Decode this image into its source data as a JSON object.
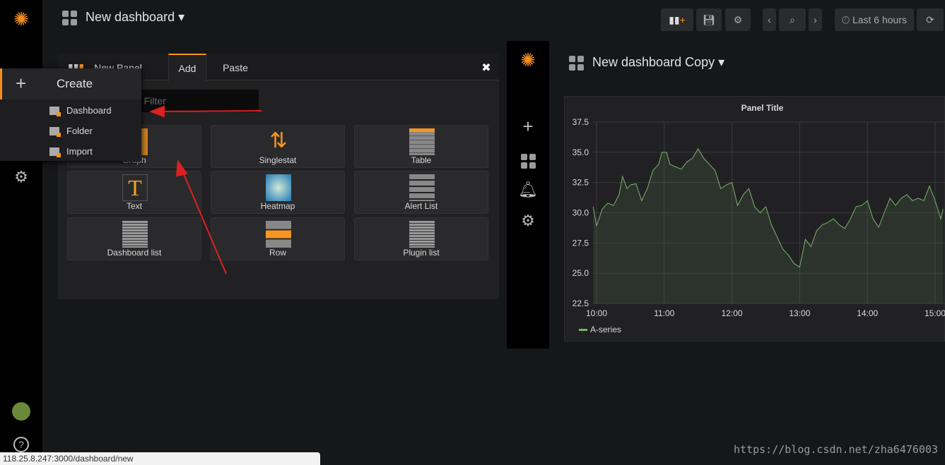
{
  "top": {
    "title": "New dashboard",
    "time_range": "Last 6 hours"
  },
  "editor": {
    "panel_label": "New Panel",
    "tabs": [
      "Add",
      "Paste"
    ],
    "active_tab": "Add",
    "filter_placeholder": "Search Filter",
    "filter_visible": "h Filter",
    "panels": [
      "Graph",
      "Singlestat",
      "Table",
      "Text",
      "Heatmap",
      "Alert List",
      "Dashboard list",
      "Row",
      "Plugin list"
    ]
  },
  "create_menu": {
    "title": "Create",
    "items": [
      "Dashboard",
      "Folder",
      "Import"
    ]
  },
  "copy": {
    "title": "New dashboard Copy"
  },
  "status_url": "118.25.8.247:3000/dashboard/new",
  "watermark": "https://blog.csdn.net/zha6476003",
  "colors": {
    "accent": "#f79520",
    "series": "#7eb26d",
    "arrow": "#e02020"
  },
  "chart_data": {
    "type": "line",
    "title": "Panel Title",
    "ylim": [
      22.5,
      37.5
    ],
    "yticks": [
      "37.5",
      "35.0",
      "32.5",
      "30.0",
      "27.5",
      "25.0",
      "22.5"
    ],
    "xticks": [
      "10:00",
      "11:00",
      "12:00",
      "13:00",
      "14:00",
      "15:00"
    ],
    "series": [
      {
        "name": "A-series",
        "x": [
          "09:57",
          "10:00",
          "10:05",
          "10:10",
          "10:15",
          "10:20",
          "10:23",
          "10:27",
          "10:30",
          "10:35",
          "10:40",
          "10:45",
          "10:50",
          "10:55",
          "10:58",
          "11:02",
          "11:05",
          "11:10",
          "11:15",
          "11:20",
          "11:25",
          "11:30",
          "11:35",
          "11:40",
          "11:45",
          "11:50",
          "11:55",
          "12:00",
          "12:05",
          "12:10",
          "12:15",
          "12:20",
          "12:25",
          "12:30",
          "12:35",
          "12:40",
          "12:45",
          "12:50",
          "12:55",
          "13:00",
          "13:05",
          "13:10",
          "13:15",
          "13:20",
          "13:25",
          "13:30",
          "13:35",
          "13:40",
          "13:45",
          "13:50",
          "13:55",
          "14:00",
          "14:05",
          "14:10",
          "14:15",
          "14:20",
          "14:25",
          "14:30",
          "14:35",
          "14:40",
          "14:45",
          "14:50",
          "14:55",
          "15:00",
          "15:05",
          "15:07"
        ],
        "values": [
          30.5,
          28.9,
          30.3,
          30.8,
          30.6,
          31.5,
          33.0,
          32.0,
          32.3,
          32.4,
          31.0,
          32.0,
          33.5,
          34.0,
          35.0,
          35.0,
          34.0,
          33.8,
          33.6,
          34.2,
          34.5,
          35.3,
          34.5,
          34.0,
          33.5,
          32.0,
          32.3,
          32.5,
          30.6,
          31.5,
          32.0,
          30.5,
          30.0,
          30.5,
          29.0,
          28.0,
          27.0,
          26.5,
          25.8,
          25.5,
          27.8,
          27.2,
          28.5,
          29.0,
          29.2,
          29.5,
          29.0,
          28.7,
          29.5,
          30.5,
          30.6,
          31.0,
          29.5,
          28.8,
          30.0,
          31.2,
          30.6,
          31.2,
          31.5,
          31.0,
          31.2,
          31.0,
          32.2,
          31.0,
          29.5,
          30.3
        ]
      }
    ]
  }
}
